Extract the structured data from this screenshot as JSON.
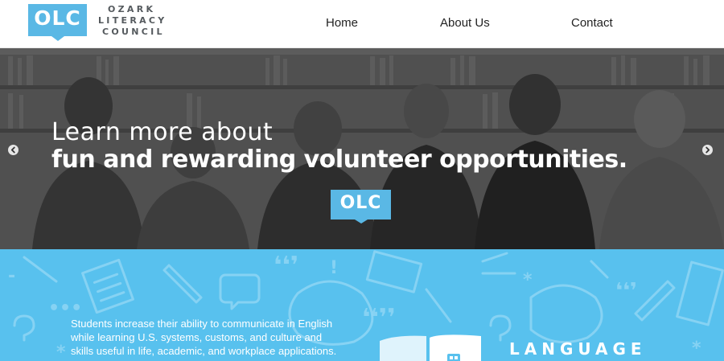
{
  "logo": {
    "badge_text": "OLC",
    "name_line1": "OZARK",
    "name_line2": "LITERACY",
    "name_line3": "COUNCIL"
  },
  "nav": {
    "home": "Home",
    "about": "About Us",
    "contact": "Contact"
  },
  "hero": {
    "line1": "Learn more about",
    "line2": "fun and rewarding volunteer opportunities.",
    "badge_text": "OLC"
  },
  "program": {
    "description": "Students increase their ability to communicate in English while learning U.S. systems, customs, and culture and skills useful in life, academic, and workplace applications.",
    "label": "LANGUAGE"
  },
  "colors": {
    "brand_blue": "#5ab8e5",
    "band_blue": "#58c1ee",
    "hero_gray": "#5b5b5b"
  }
}
